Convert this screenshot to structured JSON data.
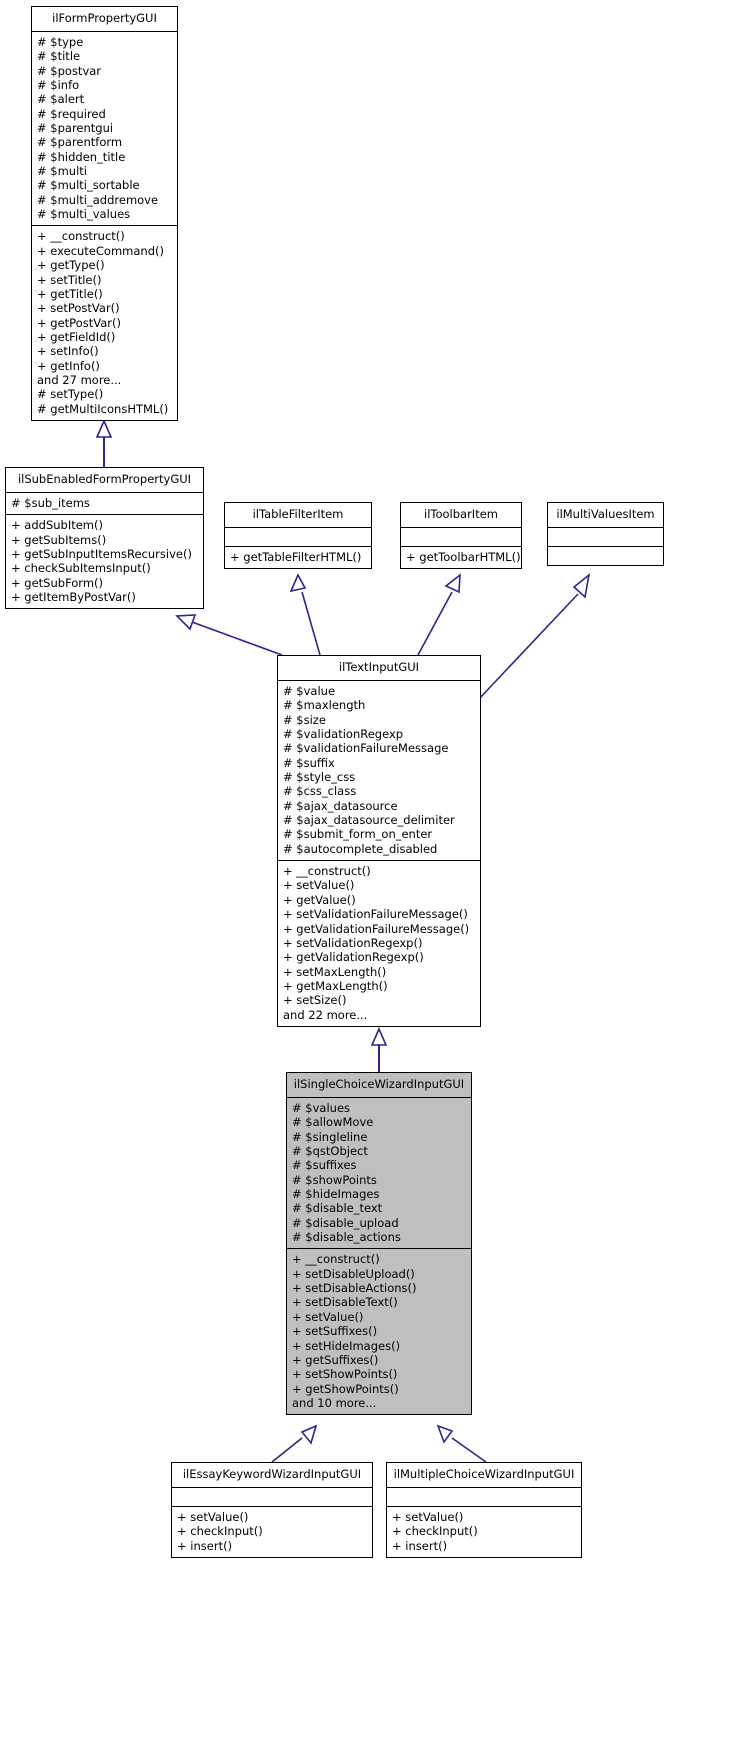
{
  "diagram": {
    "kind": "uml-class-inheritance-graph",
    "edge_color": "#27278e",
    "highlight_color": "#bfbfbf",
    "node_border_color": "#000000",
    "node_fill_color": "#ffffff"
  },
  "classes": [
    {
      "id": "ilFormPropertyGUI",
      "name": "ilFormPropertyGUI",
      "highlighted": false,
      "attributes": [
        "# $type",
        "# $title",
        "# $postvar",
        "# $info",
        "# $alert",
        "# $required",
        "# $parentgui",
        "# $parentform",
        "# $hidden_title",
        "# $multi",
        "# $multi_sortable",
        "# $multi_addremove",
        "# $multi_values"
      ],
      "methods": [
        "+ __construct()",
        "+ executeCommand()",
        "+ getType()",
        "+ setTitle()",
        "+ getTitle()",
        "+ setPostVar()",
        "+ getPostVar()",
        "+ getFieldId()",
        "+ setInfo()",
        "+ getInfo()",
        "and 27 more...",
        "# setType()",
        "# getMultiIconsHTML()"
      ]
    },
    {
      "id": "ilSubEnabledFormPropertyGUI",
      "name": "ilSubEnabledFormPropertyGUI",
      "highlighted": false,
      "attributes": [
        "# $sub_items"
      ],
      "methods": [
        "+ addSubItem()",
        "+ getSubItems()",
        "+ getSubInputItemsRecursive()",
        "+ checkSubItemsInput()",
        "+ getSubForm()",
        "+ getItemByPostVar()"
      ]
    },
    {
      "id": "ilTableFilterItem",
      "name": "ilTableFilterItem",
      "highlighted": false,
      "attributes": [],
      "methods": [
        "+ getTableFilterHTML()"
      ]
    },
    {
      "id": "ilToolbarItem",
      "name": "ilToolbarItem",
      "highlighted": false,
      "attributes": [],
      "methods": [
        "+ getToolbarHTML()"
      ]
    },
    {
      "id": "ilMultiValuesItem",
      "name": "ilMultiValuesItem",
      "highlighted": false,
      "attributes": [],
      "methods": []
    },
    {
      "id": "ilTextInputGUI",
      "name": "ilTextInputGUI",
      "highlighted": false,
      "attributes": [
        "# $value",
        "# $maxlength",
        "# $size",
        "# $validationRegexp",
        "# $validationFailureMessage",
        "# $suffix",
        "# $style_css",
        "# $css_class",
        "# $ajax_datasource",
        "# $ajax_datasource_delimiter",
        "# $submit_form_on_enter",
        "# $autocomplete_disabled"
      ],
      "methods": [
        "+ __construct()",
        "+ setValue()",
        "+ getValue()",
        "+ setValidationFailureMessage()",
        "+ getValidationFailureMessage()",
        "+ setValidationRegexp()",
        "+ getValidationRegexp()",
        "+ setMaxLength()",
        "+ getMaxLength()",
        "+ setSize()",
        "and 22 more..."
      ]
    },
    {
      "id": "ilSingleChoiceWizardInputGUI",
      "name": "ilSingleChoiceWizardInputGUI",
      "highlighted": true,
      "attributes": [
        "# $values",
        "# $allowMove",
        "# $singleline",
        "# $qstObject",
        "# $suffixes",
        "# $showPoints",
        "# $hideImages",
        "# $disable_text",
        "# $disable_upload",
        "# $disable_actions"
      ],
      "methods": [
        "+ __construct()",
        "+ setDisableUpload()",
        "+ setDisableActions()",
        "+ setDisableText()",
        "+ setValue()",
        "+ setSuffixes()",
        "+ setHideImages()",
        "+ getSuffixes()",
        "+ setShowPoints()",
        "+ getShowPoints()",
        "and 10 more..."
      ]
    },
    {
      "id": "ilEssayKeywordWizardInputGUI",
      "name": "ilEssayKeywordWizardInputGUI",
      "highlighted": false,
      "attributes": [],
      "methods": [
        "+ setValue()",
        "+ checkInput()",
        "+ insert()"
      ]
    },
    {
      "id": "ilMultipleChoiceWizardInputGUI",
      "name": "ilMultipleChoiceWizardInputGUI",
      "highlighted": false,
      "attributes": [],
      "methods": [
        "+ setValue()",
        "+ checkInput()",
        "+ insert()"
      ]
    }
  ],
  "edges": [
    {
      "from": "ilSubEnabledFormPropertyGUI",
      "to": "ilFormPropertyGUI",
      "type": "inheritance"
    },
    {
      "from": "ilTextInputGUI",
      "to": "ilSubEnabledFormPropertyGUI",
      "type": "inheritance"
    },
    {
      "from": "ilTextInputGUI",
      "to": "ilTableFilterItem",
      "type": "inheritance"
    },
    {
      "from": "ilTextInputGUI",
      "to": "ilToolbarItem",
      "type": "inheritance"
    },
    {
      "from": "ilTextInputGUI",
      "to": "ilMultiValuesItem",
      "type": "inheritance"
    },
    {
      "from": "ilSingleChoiceWizardInputGUI",
      "to": "ilTextInputGUI",
      "type": "inheritance"
    },
    {
      "from": "ilEssayKeywordWizardInputGUI",
      "to": "ilSingleChoiceWizardInputGUI",
      "type": "inheritance"
    },
    {
      "from": "ilMultipleChoiceWizardInputGUI",
      "to": "ilSingleChoiceWizardInputGUI",
      "type": "inheritance"
    }
  ]
}
